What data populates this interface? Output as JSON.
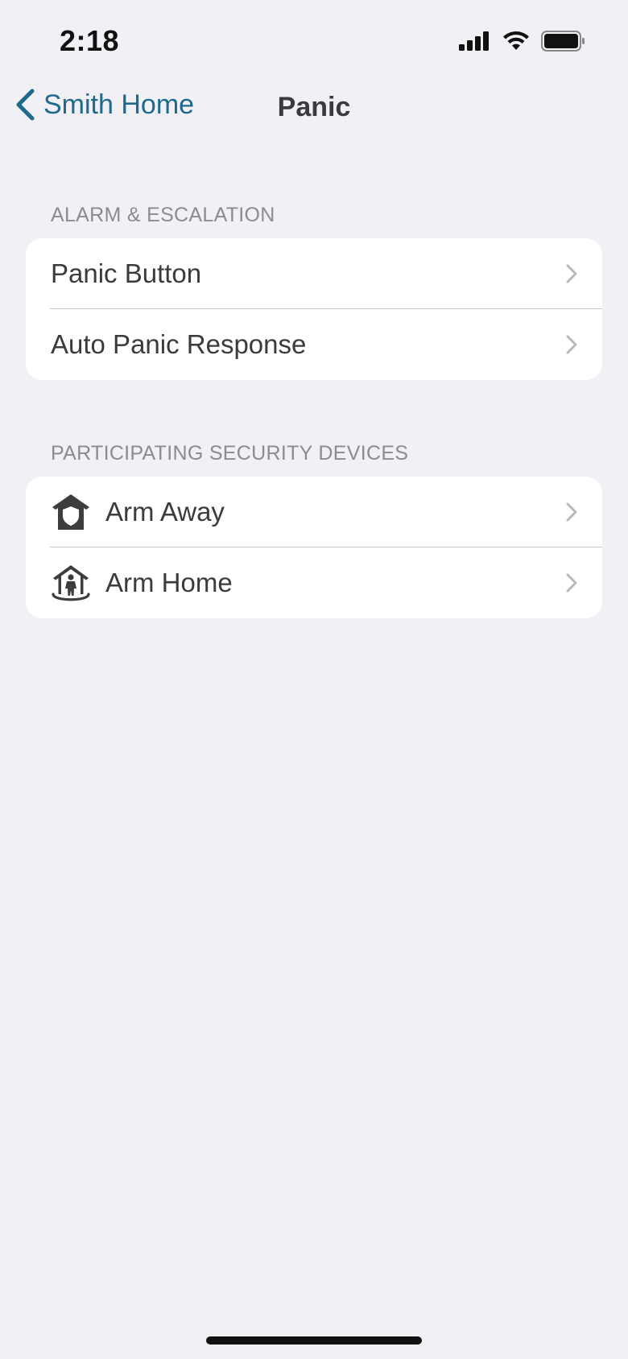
{
  "status_bar": {
    "time": "2:18",
    "icons": [
      "cellular-signal-icon",
      "wifi-icon",
      "battery-icon"
    ]
  },
  "nav": {
    "back_label": "Smith Home",
    "title": "Panic"
  },
  "sections": [
    {
      "header": "ALARM & ESCALATION",
      "items": [
        {
          "label": "Panic Button"
        },
        {
          "label": "Auto Panic Response"
        }
      ]
    },
    {
      "header": "PARTICIPATING SECURITY DEVICES",
      "items": [
        {
          "label": "Arm Away",
          "icon": "arm-away-icon"
        },
        {
          "label": "Arm Home",
          "icon": "arm-home-icon"
        }
      ]
    }
  ],
  "colors": {
    "background": "#f1f0f5",
    "accent": "#1f6a8c",
    "text": "#3b3b3e",
    "section_header": "#8b8b90"
  }
}
